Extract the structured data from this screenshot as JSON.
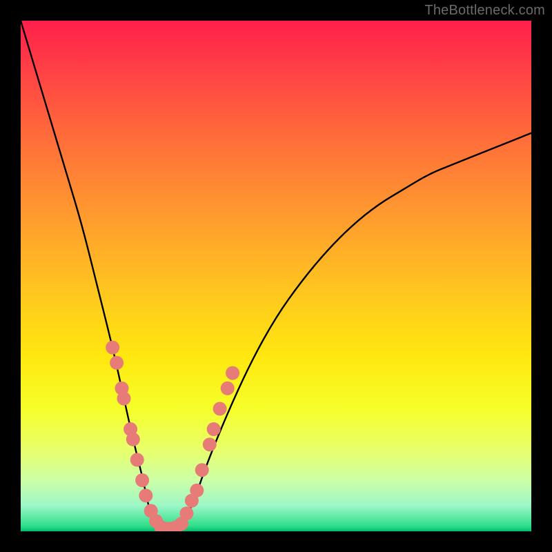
{
  "watermark": {
    "text": "TheBottleneck.com"
  },
  "chart_data": {
    "type": "line",
    "title": "",
    "xlabel": "",
    "ylabel": "",
    "xlim": [
      0,
      100
    ],
    "ylim": [
      0,
      100
    ],
    "grid": false,
    "legend": false,
    "background_gradient": {
      "direction": "vertical",
      "stops": [
        {
          "pct": 0,
          "color": "#ff1f4b"
        },
        {
          "pct": 22,
          "color": "#ff6a3b"
        },
        {
          "pct": 53,
          "color": "#ffc61f"
        },
        {
          "pct": 76,
          "color": "#f6ff2a"
        },
        {
          "pct": 95,
          "color": "#9cf7c6"
        },
        {
          "pct": 100,
          "color": "#00c06d"
        }
      ]
    },
    "series": [
      {
        "name": "bottleneck-curve",
        "color": "#000000",
        "x": [
          0,
          3,
          6,
          9,
          12,
          15,
          18,
          20,
          22,
          24,
          25,
          26,
          28,
          30,
          32,
          34,
          36,
          40,
          45,
          50,
          55,
          60,
          65,
          70,
          75,
          80,
          85,
          90,
          95,
          100
        ],
        "y": [
          100,
          90,
          80,
          70,
          60,
          48,
          36,
          27,
          18,
          10,
          5,
          2,
          0,
          0,
          2,
          6,
          12,
          22,
          33,
          42,
          49,
          55,
          60,
          64,
          67,
          70,
          72,
          74,
          76,
          78
        ]
      }
    ],
    "scatter_overlay": {
      "name": "marker-dots",
      "color": "#e77b77",
      "radius": 10,
      "points": [
        {
          "x": 18.0,
          "y": 36
        },
        {
          "x": 18.8,
          "y": 33
        },
        {
          "x": 19.8,
          "y": 28
        },
        {
          "x": 20.2,
          "y": 26
        },
        {
          "x": 21.5,
          "y": 20
        },
        {
          "x": 22.0,
          "y": 18
        },
        {
          "x": 22.8,
          "y": 14
        },
        {
          "x": 23.8,
          "y": 10
        },
        {
          "x": 24.5,
          "y": 7
        },
        {
          "x": 25.5,
          "y": 4
        },
        {
          "x": 26.5,
          "y": 2
        },
        {
          "x": 27.5,
          "y": 0.8
        },
        {
          "x": 28.5,
          "y": 0.5
        },
        {
          "x": 29.5,
          "y": 0.5
        },
        {
          "x": 30.5,
          "y": 0.8
        },
        {
          "x": 31.5,
          "y": 1.5
        },
        {
          "x": 32.5,
          "y": 3.5
        },
        {
          "x": 33.5,
          "y": 6
        },
        {
          "x": 34.5,
          "y": 8
        },
        {
          "x": 35.5,
          "y": 12
        },
        {
          "x": 37.0,
          "y": 17
        },
        {
          "x": 37.8,
          "y": 20
        },
        {
          "x": 39.0,
          "y": 24
        },
        {
          "x": 40.5,
          "y": 28
        },
        {
          "x": 41.5,
          "y": 31
        }
      ]
    }
  }
}
